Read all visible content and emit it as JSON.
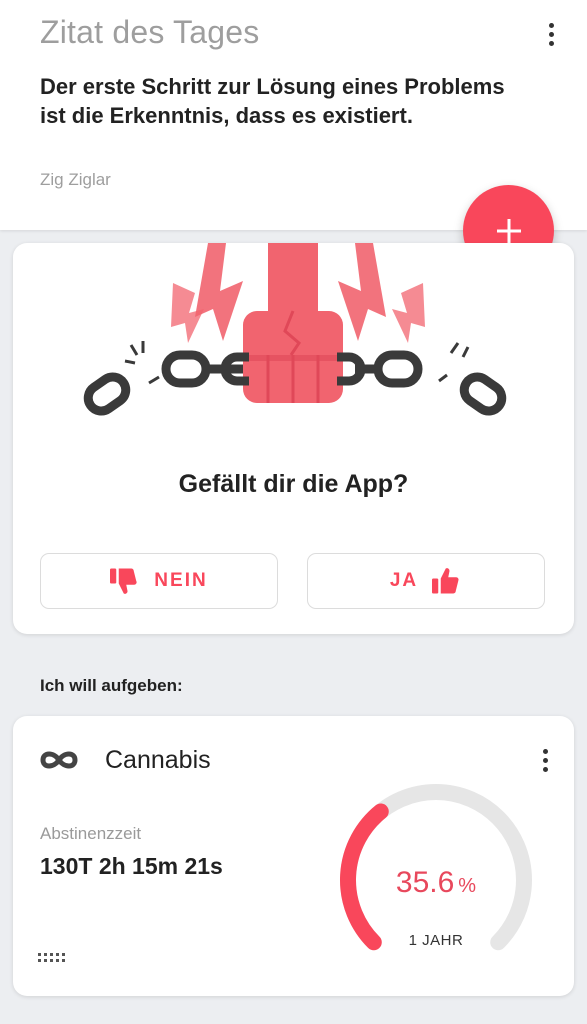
{
  "quote": {
    "header": "Zitat des Tages",
    "text": "Der erste Schritt zur Lösung eines Problems ist die Erkenntnis, dass es existiert.",
    "author": "Zig Ziglar"
  },
  "rating": {
    "question": "Gefällt dir die App?",
    "no_label": "NEIN",
    "yes_label": "JA"
  },
  "section": {
    "title": "Ich will aufgeben:"
  },
  "habit": {
    "name": "Cannabis",
    "icon": "infinity-icon",
    "abstinence_label": "Abstinenzzeit",
    "abstinence_value": "130T 2h 15m 21s",
    "progress_value": "35.6",
    "progress_unit": "%",
    "progress_fraction": 0.356,
    "progress_period": "1 JAHR"
  },
  "colors": {
    "accent": "#f9475b",
    "fist": "#f1646f",
    "track": "#e6e6e6"
  }
}
